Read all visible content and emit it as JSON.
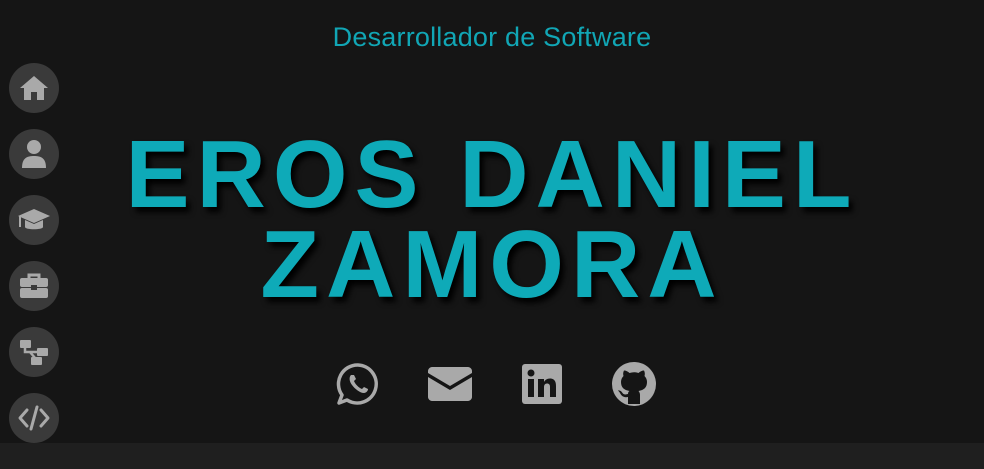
{
  "header": {
    "subtitle": "Desarrollador de Software",
    "name_line1": "EROS DANIEL",
    "name_line2": "ZAMORA"
  },
  "sidebar": {
    "items": [
      {
        "icon": "home-icon"
      },
      {
        "icon": "user-icon"
      },
      {
        "icon": "graduation-cap-icon"
      },
      {
        "icon": "briefcase-icon"
      },
      {
        "icon": "sitemap-icon"
      },
      {
        "icon": "code-icon"
      }
    ]
  },
  "social": [
    {
      "icon": "whatsapp-icon"
    },
    {
      "icon": "envelope-icon"
    },
    {
      "icon": "linkedin-icon"
    },
    {
      "icon": "github-icon"
    }
  ],
  "colors": {
    "background": "#151515",
    "accent": "#0eaab8",
    "icon_gray": "#a9a9a9",
    "nav_bg": "#3a3a3a"
  }
}
